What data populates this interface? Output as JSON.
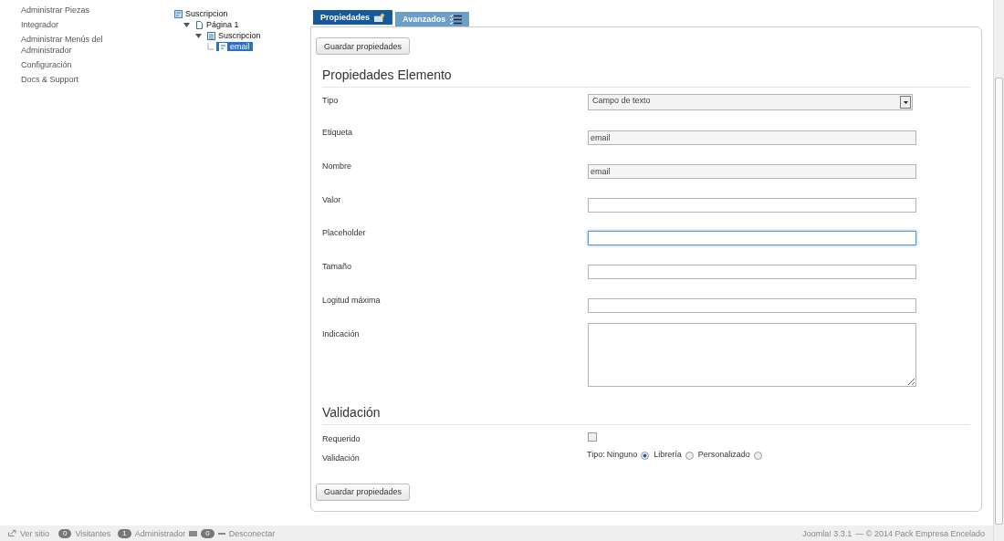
{
  "sidebar": {
    "items": [
      "Administrar Piezas",
      "Integrador",
      "Administrar Menús del Administrador",
      "Configuración",
      "Docs & Support"
    ]
  },
  "tree": [
    {
      "label": "Suscripcion",
      "kind": "form",
      "selected": false,
      "children": [
        {
          "label": "Página 1",
          "kind": "page",
          "expanded": true,
          "selected": false,
          "children": [
            {
              "label": "Suscripcion",
              "kind": "section",
              "expanded": true,
              "selected": false,
              "children": [
                {
                  "label": "email",
                  "kind": "field",
                  "selected": true
                }
              ]
            }
          ]
        }
      ]
    }
  ],
  "tabs": [
    {
      "label": "Propiedades",
      "kind": "properties",
      "selected": true
    },
    {
      "label": "Avanzados",
      "kind": "advanced",
      "selected": false
    }
  ],
  "save_buttons": [
    "Guardar propiedades",
    "Guardar propiedades"
  ],
  "properties": {
    "title": "Propiedades Elemento",
    "fields": [
      {
        "label": "Tipo",
        "kind": "select",
        "value": "Campo de texto"
      },
      {
        "label": "Etiqueta",
        "kind": "text",
        "value": "email"
      },
      {
        "label": "Nombre",
        "kind": "text",
        "value": "email"
      },
      {
        "label": "Valor",
        "kind": "text"
      },
      {
        "label": "Placeholder",
        "kind": "text",
        "focused": true
      },
      {
        "label": "Tamaño",
        "kind": "text"
      },
      {
        "label": "Logitud máxima",
        "kind": "text"
      },
      {
        "label": "Indicación",
        "kind": "textarea"
      }
    ]
  },
  "validation": {
    "title": "Validación",
    "required": {
      "label": "Requerido",
      "checked": false
    },
    "type": {
      "label": "Validación",
      "prefix": "Tipo:",
      "options": [
        {
          "label": "Ninguno",
          "selected": true
        },
        {
          "label": "Librería",
          "selected": false
        },
        {
          "label": "Personalizado",
          "selected": false
        }
      ]
    }
  },
  "footer": {
    "view_site": "Ver sitio",
    "visitors": {
      "count": "0",
      "label": "Visitantes"
    },
    "admins": {
      "count": "1",
      "label": "Administrador"
    },
    "messages": {
      "count": "0"
    },
    "logout": "Desconectar",
    "version": "Joomla! 3.3.1",
    "copyright": "— © 2014 Pack Empresa Encelado"
  }
}
